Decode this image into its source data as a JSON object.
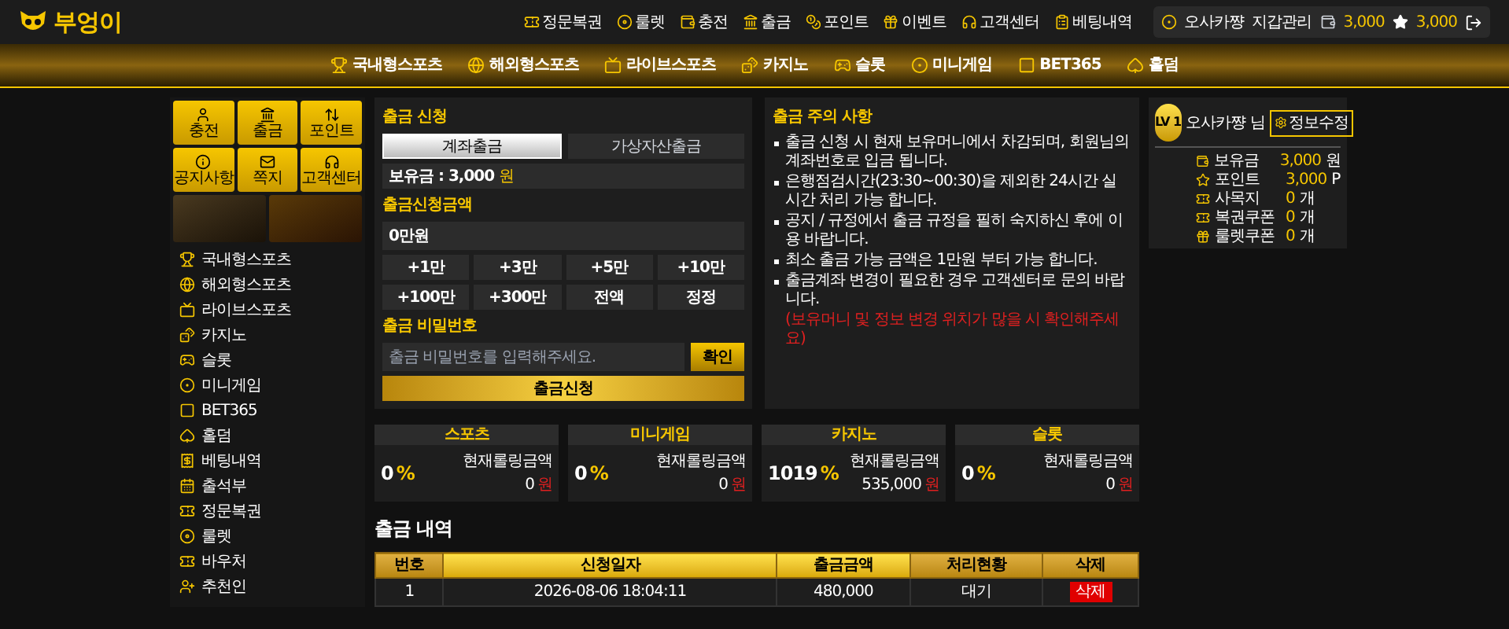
{
  "header": {
    "logo": "부엉이",
    "links": [
      "정문복권",
      "룰렛",
      "충전",
      "출금",
      "포인트",
      "이벤트",
      "고객센터",
      "베팅내역"
    ],
    "user": {
      "name": "오사카쨩",
      "wallet": "지갑관리",
      "money": "3,000",
      "points": "3,000"
    }
  },
  "main_nav": [
    "국내형스포츠",
    "해외형스포츠",
    "라이브스포츠",
    "카지노",
    "슬롯",
    "미니게임",
    "BET365",
    "홀덤"
  ],
  "sidebar": {
    "quick_buttons": [
      "충전",
      "출금",
      "포인트",
      "공지사항",
      "쪽지",
      "고객센터"
    ],
    "items": [
      "국내형스포츠",
      "해외형스포츠",
      "라이브스포츠",
      "카지노",
      "슬롯",
      "미니게임",
      "BET365",
      "홀덤",
      "베팅내역",
      "출석부",
      "정문복권",
      "룰렛",
      "바우처",
      "추천인"
    ]
  },
  "withdraw_form": {
    "title": "출금 신청",
    "tabs": [
      {
        "label": "계좌출금",
        "selected": true
      },
      {
        "label": "가상자산출금",
        "selected": false
      }
    ],
    "balance": "보유금 : 3,000",
    "balance_unit": "원",
    "amount_label": "출금신청금액",
    "amount_value": "0만원",
    "amount_buttons": [
      "+1만",
      "+3만",
      "+5만",
      "+10만",
      "+100만",
      "+300만",
      "전액",
      "정정"
    ],
    "password_label": "출금 비밀번호",
    "password_placeholder": "출금 비밀번호를 입력해주세요.",
    "confirm": "확인",
    "submit": "출금신청"
  },
  "notice": {
    "title": "출금 주의 사항",
    "items": [
      "출금 신청 시 현재 보유머니에서 차감되며, 회원님의 계좌번호로 입금 됩니다.",
      "은행점검시간(23:30~00:30)을 제외한 24시간 실시간 처리 가능 합니다.",
      "공지 / 규정에서 출금 규정을 필히 숙지하신 후에 이용 바랍니다.",
      "최소 출금 가능 금액은 1만원 부터 가능 합니다.",
      "출금계좌 변경이 필요한 경우 고객센터로 문의 바랍니다."
    ],
    "warning": "(보유머니 및 정보 변경 위치가 많을 시 확인해주세요)"
  },
  "profile": {
    "level": "LV 1",
    "name": "오사카쨩",
    "suffix": "님",
    "edit": "정보수정",
    "stats": [
      {
        "label": "보유금",
        "value": "3,000",
        "unit": "원"
      },
      {
        "label": "포인트",
        "value": "3,000",
        "unit": "P"
      },
      {
        "label": "사목지",
        "value": "0",
        "unit": "개"
      },
      {
        "label": "복권쿠폰",
        "value": "0",
        "unit": "개"
      },
      {
        "label": "룰렛쿠폰",
        "value": "0",
        "unit": "개"
      }
    ]
  },
  "rolling": [
    {
      "title": "스포츠",
      "percent": "0",
      "sign": "%",
      "label": "현재롤링금액",
      "amount": "0",
      "unit": "원"
    },
    {
      "title": "미니게임",
      "percent": "0",
      "sign": "%",
      "label": "현재롤링금액",
      "amount": "0",
      "unit": "원"
    },
    {
      "title": "카지노",
      "percent": "1019",
      "sign": "%",
      "label": "현재롤링금액",
      "amount": "535,000",
      "unit": "원"
    },
    {
      "title": "슬롯",
      "percent": "0",
      "sign": "%",
      "label": "현재롤링금액",
      "amount": "0",
      "unit": "원"
    }
  ],
  "history": {
    "title": "출금 내역",
    "columns": [
      "번호",
      "신청일자",
      "출금금액",
      "처리현황",
      "삭제"
    ],
    "rows": [
      {
        "cells": [
          "1",
          "2026-08-06 18:04:11",
          "480,000",
          "대기"
        ],
        "action": "삭제"
      }
    ]
  }
}
